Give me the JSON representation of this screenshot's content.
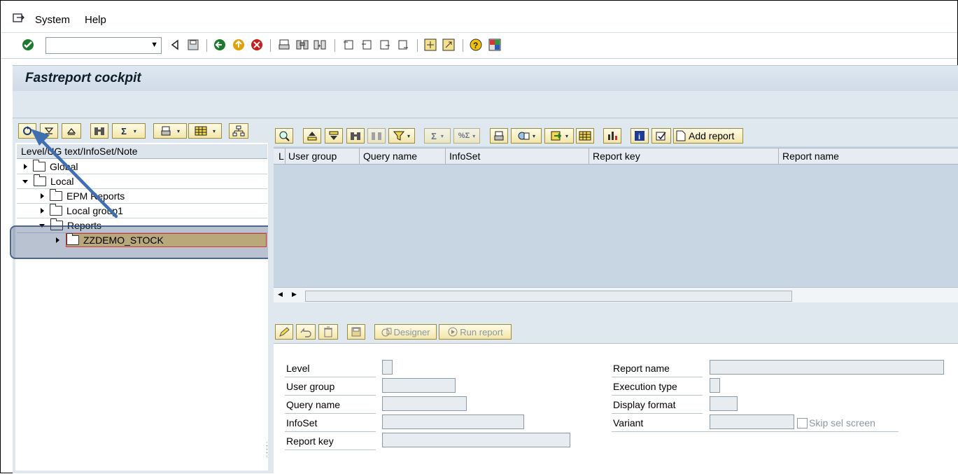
{
  "menu": {
    "items": [
      {
        "label": "System"
      },
      {
        "label": "Help"
      }
    ]
  },
  "title": "Fastreport cockpit",
  "tree": {
    "header": "Level/UG text/InfoSet/Note",
    "nodes": [
      {
        "label": "Global"
      },
      {
        "label": "Local"
      },
      {
        "label": "EPM Reports"
      },
      {
        "label": "Local group1"
      },
      {
        "label": "Reports"
      },
      {
        "label": "ZZDEMO_STOCK"
      }
    ]
  },
  "grid": {
    "add_report": "Add report",
    "columns": [
      "L",
      "User group",
      "Query name",
      "InfoSet",
      "Report key",
      "Report name"
    ]
  },
  "actions": {
    "designer": "Designer",
    "run_report": "Run report"
  },
  "form": {
    "level": "Level",
    "user_group": "User group",
    "query_name": "Query name",
    "infoset": "InfoSet",
    "report_key": "Report key",
    "report_name": "Report name",
    "execution_type": "Execution type",
    "display_format": "Display format",
    "variant": "Variant",
    "skip_sel_screen": "Skip sel screen"
  },
  "colors": {
    "accent_arrow": "#3f6fb0",
    "selection": "#b9a87a",
    "panel": "#dfe7ef"
  }
}
